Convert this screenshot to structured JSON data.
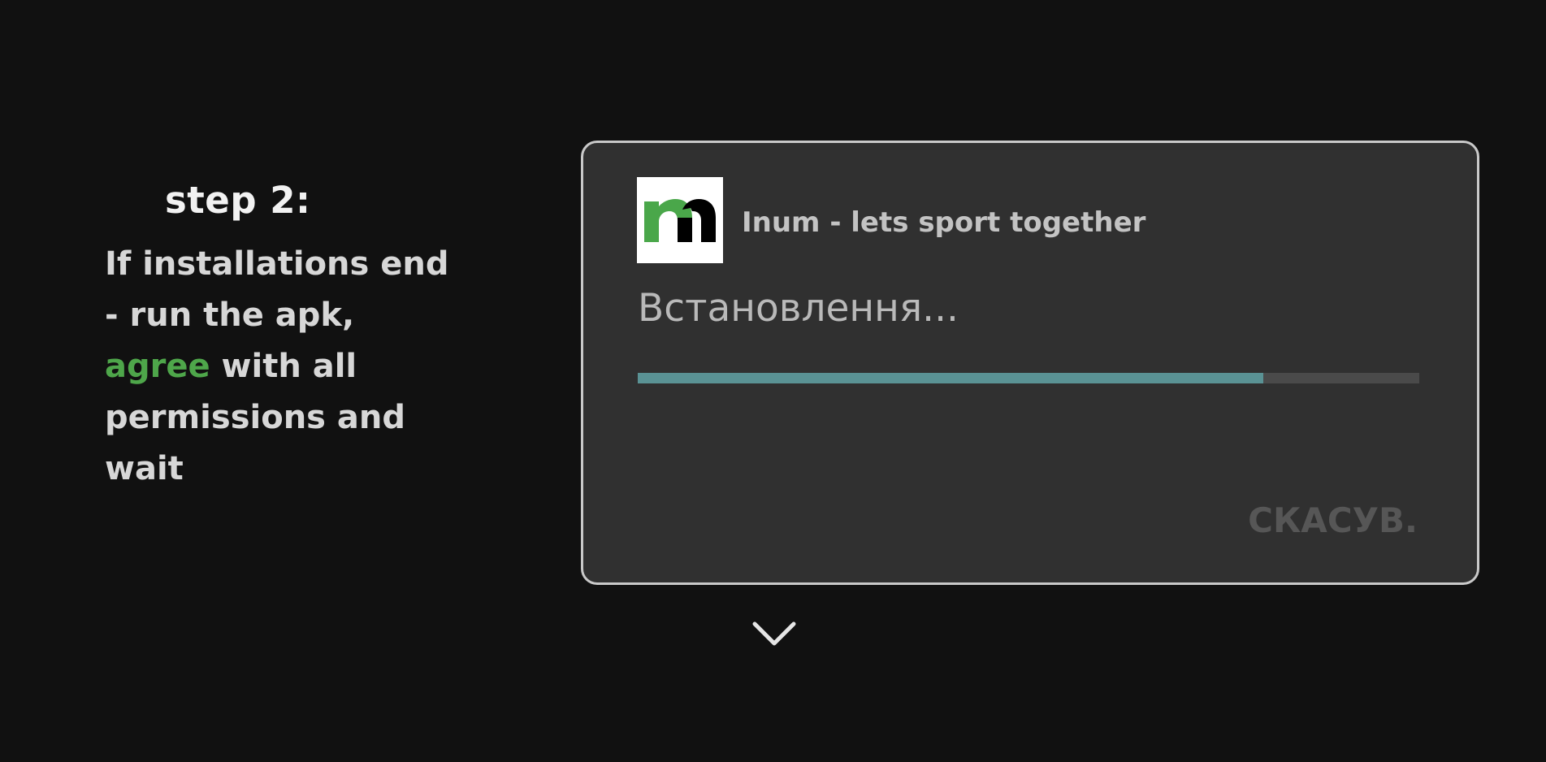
{
  "instructions": {
    "step_title": "step 2:",
    "line1": "If installations end",
    "line2": "- run the apk,",
    "highlight": "agree",
    "line3_rest": " with all",
    "line4": "permissions and",
    "line5": "wait"
  },
  "dialog": {
    "app_icon": "inum-logo-icon",
    "app_name": "Inum - lets sport together",
    "status": "Встановлення...",
    "progress": 0.8,
    "cancel_label": "СКАСУВ."
  },
  "chevron_icon": "chevron-down-icon",
  "colors": {
    "background": "#111111",
    "highlight": "#4ea64a",
    "dialog_bg": "#303030",
    "progress_fill": "#5a9294",
    "progress_track": "#4a4a4a"
  }
}
